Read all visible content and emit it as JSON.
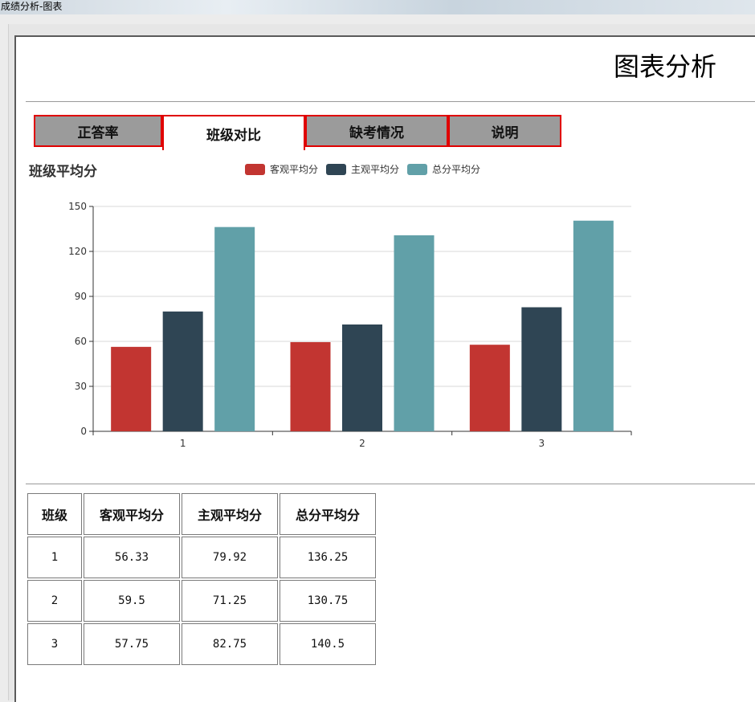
{
  "window": {
    "title": "成绩分析-图表"
  },
  "page": {
    "title": "图表分析"
  },
  "tabs": [
    {
      "label": "正答率",
      "active": false
    },
    {
      "label": "班级对比",
      "active": true
    },
    {
      "label": "缺考情况",
      "active": false
    },
    {
      "label": "说明",
      "active": false
    }
  ],
  "chart_data": {
    "type": "bar",
    "title": "班级平均分",
    "categories": [
      "1",
      "2",
      "3"
    ],
    "series": [
      {
        "name": "客观平均分",
        "color": "#c23531",
        "values": [
          56.33,
          59.5,
          57.75
        ]
      },
      {
        "name": "主观平均分",
        "color": "#2f4554",
        "values": [
          79.92,
          71.25,
          82.75
        ]
      },
      {
        "name": "总分平均分",
        "color": "#61a0a8",
        "values": [
          136.25,
          130.75,
          140.5
        ]
      }
    ],
    "ylim": [
      0,
      150
    ],
    "yticks": [
      "0",
      "30",
      "60",
      "90",
      "120",
      "150"
    ],
    "grid": true,
    "legend_position": "top-center"
  },
  "table": {
    "headers": [
      "班级",
      "客观平均分",
      "主观平均分",
      "总分平均分"
    ],
    "rows": [
      [
        "1",
        "56.33",
        "79.92",
        "136.25"
      ],
      [
        "2",
        "59.5",
        "71.25",
        "130.75"
      ],
      [
        "3",
        "57.75",
        "82.75",
        "140.5"
      ]
    ]
  }
}
